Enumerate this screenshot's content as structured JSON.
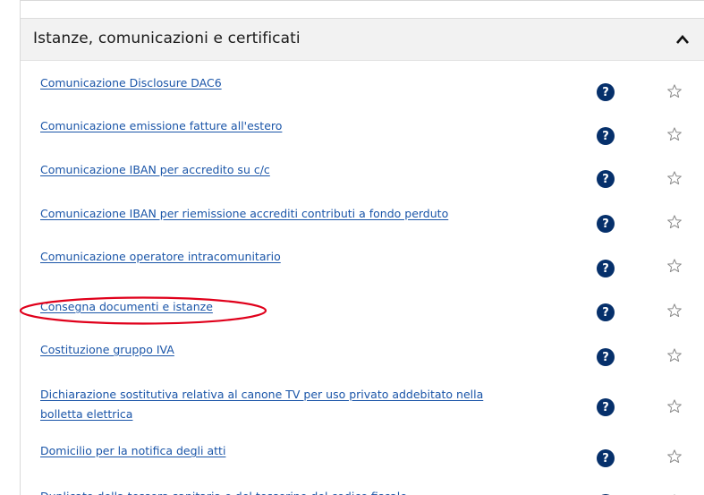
{
  "section": {
    "title": "Istanze, comunicazioni e certificati",
    "collapse_icon": "chevron-up-icon"
  },
  "items": [
    {
      "label": "Comunicazione Disclosure DAC6"
    },
    {
      "label": "Comunicazione emissione fatture all'estero"
    },
    {
      "label": "Comunicazione IBAN per accredito su c/c"
    },
    {
      "label": "Comunicazione IBAN per riemissione accrediti contributi a fondo perduto"
    },
    {
      "label": "Comunicazione operatore intracomunitario"
    },
    {
      "label": "Consegna documenti e istanze"
    },
    {
      "label": "Costituzione gruppo IVA"
    },
    {
      "label_line1": "Dichiarazione sostitutiva relativa al canone TV per uso privato addebitato nella",
      "label_line2": "bolletta elettrica"
    },
    {
      "label": "Domicilio per la notifica degli atti"
    },
    {
      "label": "Duplicato della tessera sanitaria e del tesserino del codice fiscale"
    }
  ],
  "help_icon_glyph": "?",
  "colors": {
    "link": "#1a55a8",
    "help_icon_bg": "#06306b",
    "header_bg": "#f2f2f2",
    "highlight": "#e0001b"
  }
}
